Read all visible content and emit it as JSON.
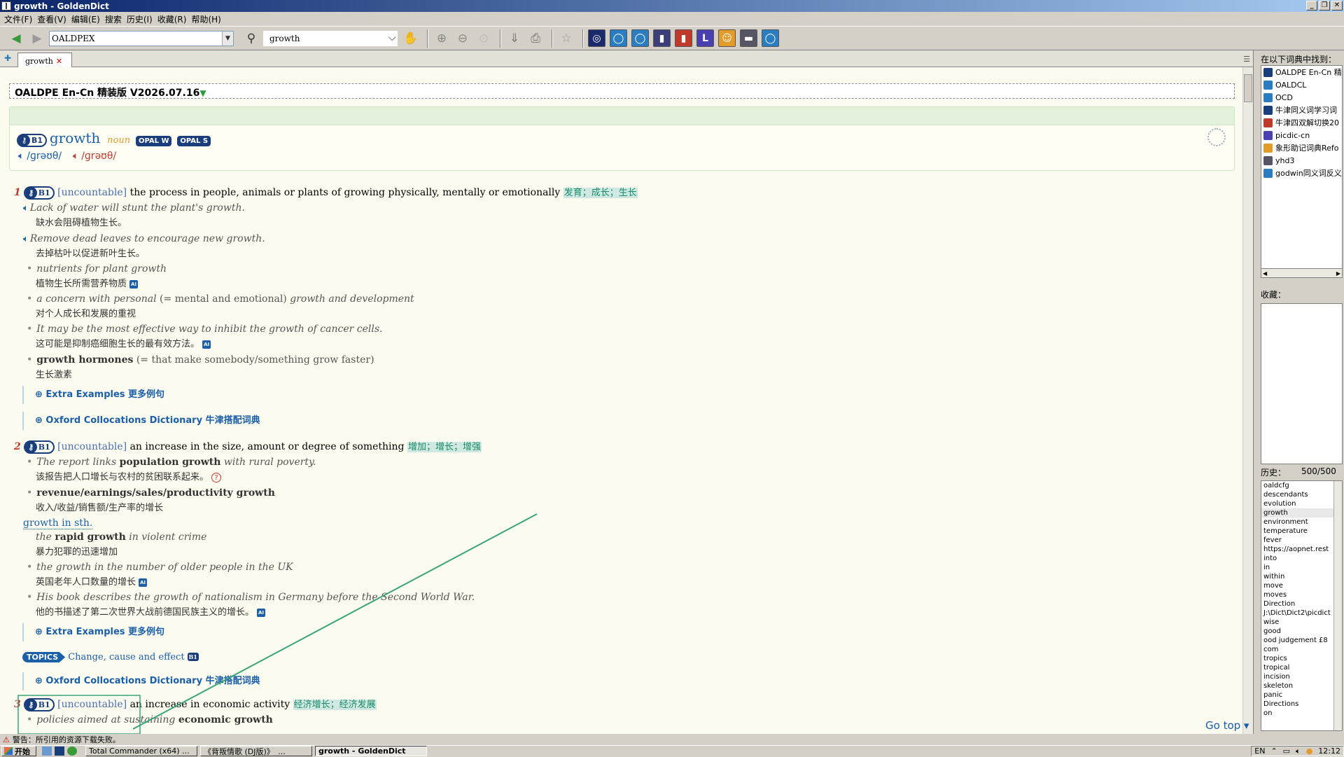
{
  "window": {
    "title": "growth - GoldenDict"
  },
  "menu": [
    "文件(F)",
    "查看(V)",
    "编辑(E)",
    "搜索",
    "历史(I)",
    "收藏(R)",
    "帮助(H)"
  ],
  "toolbar": {
    "group": "OALDPEX",
    "search_value": "growth"
  },
  "tab": {
    "label": "growth"
  },
  "entry": {
    "dict_header": "OALDPE En-Cn 精装版 V2026.07.16",
    "headword": "growth",
    "pos": "noun",
    "cefr": "B1",
    "opal_w": "OPAL W",
    "opal_s": "OPAL S",
    "pron_uk": "/ɡrəʊθ/",
    "pron_us": "/ɡrəʊθ/",
    "senses": [
      {
        "num": "1",
        "grammar": "[uncountable]",
        "def": "the process in people, animals or plants of growing physically, mentally or emotionally",
        "cn": "发育；成长；生长",
        "examples": [
          {
            "en": "Lack of water will stunt the plant's growth.",
            "cn": "缺水会阻碍植物生长。"
          },
          {
            "en": "Remove dead leaves to encourage new growth.",
            "cn": "去掉枯叶以促进新叶生长。"
          },
          {
            "en": "nutrients for plant growth",
            "cn": "植物生长所需营养物质"
          },
          {
            "en_a": "a concern with personal",
            "en_b": "(= mental and emotional)",
            "en_c": "growth and development",
            "cn": "对个人成长和发展的重视"
          },
          {
            "en": "It may be the most effective way to inhibit the growth of cancer cells.",
            "cn": "这可能是抑制癌细胞生长的最有效方法。"
          },
          {
            "en_bold": "growth hormones",
            "en_rest": "(= that make somebody/something grow faster)",
            "cn": "生长激素"
          }
        ],
        "folds": [
          "Extra Examples 更多例句",
          "Oxford Collocations Dictionary 牛津搭配词典"
        ]
      },
      {
        "num": "2",
        "grammar": "[uncountable]",
        "def": "an increase in the size, amount or degree of something",
        "cn": "增加；增长；增强",
        "ex1": {
          "pre": "The report links",
          "bold": "population growth",
          "post": "with rural poverty.",
          "cn": "该报告把人口增长与农村的贫困联系起来。"
        },
        "ex2": {
          "bold": "revenue/earnings/sales/productivity growth",
          "cn": "收入/收益/销售额/生产率的增长"
        },
        "pattern": "growth in sth.",
        "ex3": {
          "pre": "the",
          "bold": "rapid growth",
          "post": "in violent crime",
          "cn": "暴力犯罪的迅速增加"
        },
        "ex4": {
          "en": "the growth in the number of older people in the UK",
          "cn": "英国老年人口数量的增长"
        },
        "ex5": {
          "en": "His book describes the growth of nationalism in Germany before the Second World War.",
          "cn": "他的书描述了第二次世界大战前德国民族主义的增长。"
        },
        "extra": "Extra Examples 更多例句",
        "topics_badge": "TOPICS",
        "topics_link": "Change, cause and effect",
        "topics_level": "B1",
        "collocations": "Oxford Collocations Dictionary 牛津搭配词典"
      },
      {
        "num": "3",
        "grammar": "[uncountable]",
        "def": "an increase in economic activity",
        "cn": "经济增长；经济发展",
        "ex1": {
          "pre": "policies aimed at sustaining",
          "bold": "economic growth"
        }
      }
    ],
    "go_top": "Go top"
  },
  "status": {
    "warning": "警告：所引用的资源下载失败。"
  },
  "right_pane": {
    "found_label": "在以下词典中找到：",
    "dicts": [
      {
        "name": "OALDPE En-Cn 精装",
        "color": "#1a3d7c"
      },
      {
        "name": "OALDCL",
        "color": "#2a7dc0"
      },
      {
        "name": "OCD",
        "color": "#2a7dc0"
      },
      {
        "name": "牛津同义词学习词",
        "color": "#1a3d7c"
      },
      {
        "name": "牛津四双解切换20",
        "color": "#c0392b"
      },
      {
        "name": "picdic-cn",
        "color": "#4a3fb0"
      },
      {
        "name": "象形助记词典Refo",
        "color": "#e39b2a"
      },
      {
        "name": "yhd3",
        "color": "#556"
      },
      {
        "name": "godwin同义词反义",
        "color": "#2a7dc0"
      }
    ],
    "fav_label": "收藏：",
    "history_label": "历史：",
    "history_count": "500/500",
    "history": [
      "oaldcfg",
      "descendants",
      "evolution",
      "growth",
      "environment",
      "temperature",
      "fever",
      "https://aopnet.rest",
      "into",
      "in",
      "within",
      "move",
      "moves",
      "Direction",
      "J:\\Dict\\Dict2\\picdict",
      "wise",
      "good",
      "ood judgement £8",
      "com",
      "tropics",
      "tropical",
      "incision",
      "skeleton",
      "panic",
      "Directions",
      "on"
    ]
  },
  "taskbar": {
    "start": "开始",
    "tasks": [
      "Total Commander (x64) ...",
      "《背叛情歌 (DJ版)》_...",
      "growth - GoldenDict"
    ],
    "lang": "EN",
    "time": "12:12"
  }
}
